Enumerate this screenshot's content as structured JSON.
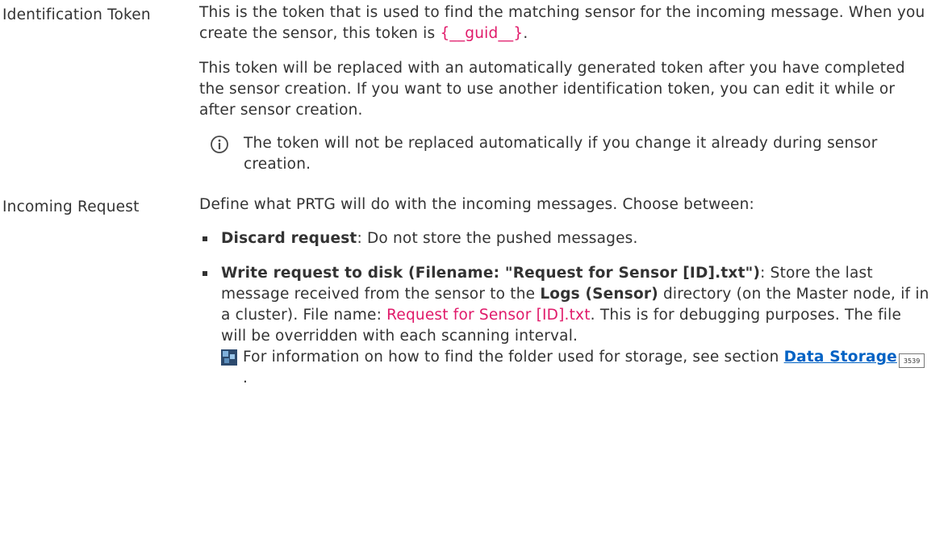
{
  "identification_token": {
    "label": "Identification Token",
    "para1_text": "This is the token that is used to find the matching sensor for the incoming message. When you create the sensor, this token is ",
    "para1_token": "{__guid__}",
    "para1_end": ".",
    "para2": "This token will be replaced with an automatically generated token after you have completed the sensor creation. If you want to use another identification token, you can edit it while or after sensor creation.",
    "note": "The token will not be replaced automatically if you change it already during sensor creation."
  },
  "incoming_request": {
    "label": "Incoming Request",
    "intro": "Define what PRTG will do with the incoming messages. Choose between:",
    "options": [
      {
        "title": "Discard request",
        "text": ": Do not store the pushed messages."
      },
      {
        "title": "Write request to disk (Filename: \"Request for Sensor [ID].txt\")",
        "text1": ": Store the last message received from the sensor to the ",
        "bold_dir": "Logs (Sensor)",
        "text2": " directory (on the Master node, if in a cluster). File name: ",
        "filename": "Request for Sensor [ID].txt",
        "text3": ". This is for debugging purposes. The file will be overridden with each scanning interval."
      }
    ],
    "see_also_text": "For information on how to find the folder used for storage, see section ",
    "see_also_link": "Data Storage",
    "see_also_page": "3539",
    "see_also_end": "."
  },
  "icons": {
    "info": "info-circle-icon",
    "book": "book-reference-icon"
  },
  "colors": {
    "text": "#333333",
    "highlight": "#e01a6a",
    "link": "#0062c4"
  }
}
